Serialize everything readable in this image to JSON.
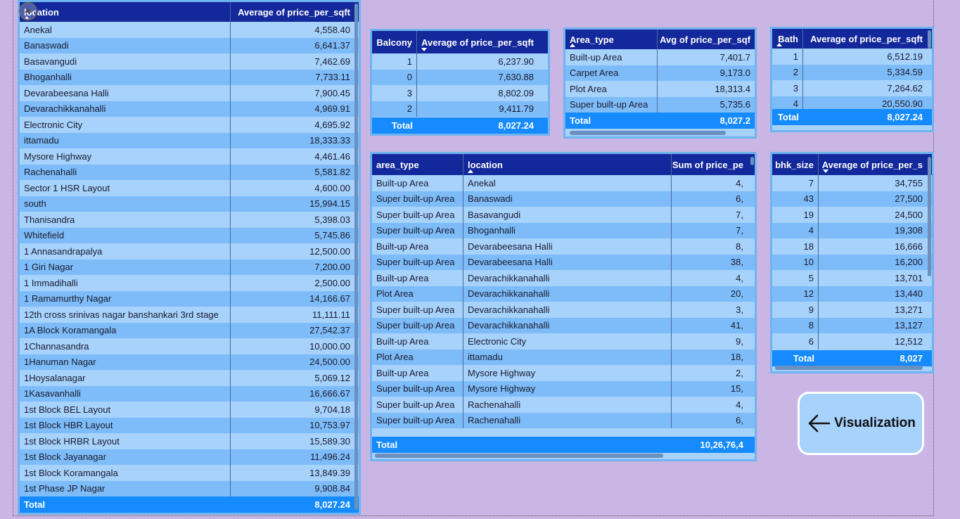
{
  "colors": {
    "header_bg": "#13289a",
    "row_light": "#a6d2fc",
    "row_dark": "#7dbcf8",
    "total_bg": "#168bff",
    "page_bg": "#c9b6e4"
  },
  "location_table": {
    "headers": [
      "location",
      "Average of price_per_sqft"
    ],
    "rows": [
      [
        "Anekal",
        "4,558.40"
      ],
      [
        "Banaswadi",
        "6,641.37"
      ],
      [
        "Basavangudi",
        "7,462.69"
      ],
      [
        "Bhoganhalli",
        "7,733.11"
      ],
      [
        "Devarabeesana Halli",
        "7,900.45"
      ],
      [
        "Devarachikkanahalli",
        "4,969.91"
      ],
      [
        "Electronic City",
        "4,695.92"
      ],
      [
        "ittamadu",
        "18,333.33"
      ],
      [
        "Mysore Highway",
        "4,461.46"
      ],
      [
        "Rachenahalli",
        "5,581.82"
      ],
      [
        "Sector 1 HSR Layout",
        "4,600.00"
      ],
      [
        "south",
        "15,994.15"
      ],
      [
        "Thanisandra",
        "5,398.03"
      ],
      [
        "Whitefield",
        "5,745.86"
      ],
      [
        "1 Annasandrapalya",
        "12,500.00"
      ],
      [
        "1 Giri Nagar",
        "7,200.00"
      ],
      [
        "1 Immadihalli",
        "2,500.00"
      ],
      [
        "1 Ramamurthy Nagar",
        "14,166.67"
      ],
      [
        "12th cross srinivas nagar banshankari 3rd stage",
        "11,111.11"
      ],
      [
        "1A Block Koramangala",
        "27,542.37"
      ],
      [
        "1Channasandra",
        "10,000.00"
      ],
      [
        "1Hanuman Nagar",
        "24,500.00"
      ],
      [
        "1Hoysalanagar",
        "5,069.12"
      ],
      [
        "1Kasavanhalli",
        "16,666.67"
      ],
      [
        "1st Block BEL Layout",
        "9,704.18"
      ],
      [
        "1st Block HBR Layout",
        "10,753.97"
      ],
      [
        "1st Block HRBR Layout",
        "15,589.30"
      ],
      [
        "1st Block Jayanagar",
        "11,496.24"
      ],
      [
        "1st Block Koramangala",
        "13,849.39"
      ],
      [
        "1st Phase JP Nagar",
        "9,908.84"
      ]
    ],
    "total": [
      "Total",
      "8,027.24"
    ]
  },
  "balcony_table": {
    "headers": [
      "Balcony",
      "Average of price_per_sqft"
    ],
    "rows": [
      [
        "1",
        "6,237.90"
      ],
      [
        "0",
        "7,630.88"
      ],
      [
        "3",
        "8,802.09"
      ],
      [
        "2",
        "9,411.79"
      ]
    ],
    "total": [
      "Total",
      "8,027.24"
    ]
  },
  "area_type_table": {
    "headers": [
      "Area_type",
      "Avg of price_per_sqf"
    ],
    "rows": [
      [
        "Built-up Area",
        "7,401.7"
      ],
      [
        "Carpet Area",
        "9,173.0"
      ],
      [
        "Plot Area",
        "18,313.4"
      ],
      [
        "Super built-up Area",
        "5,735.6"
      ]
    ],
    "total": [
      "Total",
      "8,027.2"
    ]
  },
  "bath_table": {
    "headers": [
      "Bath",
      "Average of price_per_sqft"
    ],
    "rows": [
      [
        "1",
        "6,512.19"
      ],
      [
        "2",
        "5,334.59"
      ],
      [
        "3",
        "7,264.62"
      ],
      [
        "4",
        "20,550.90"
      ]
    ],
    "total": [
      "Total",
      "8,027.24"
    ]
  },
  "area_location_table": {
    "headers": [
      "area_type",
      "location",
      "Sum of price_pe"
    ],
    "rows": [
      [
        "Built-up Area",
        "Anekal",
        "4,"
      ],
      [
        "Super built-up Area",
        "Banaswadi",
        "6,"
      ],
      [
        "Super built-up Area",
        "Basavangudi",
        "7,"
      ],
      [
        "Super built-up Area",
        "Bhoganhalli",
        "7,"
      ],
      [
        "Built-up Area",
        "Devarabeesana Halli",
        "8,"
      ],
      [
        "Super built-up Area",
        "Devarabeesana Halli",
        "38,"
      ],
      [
        "Built-up Area",
        "Devarachikkanahalli",
        "4,"
      ],
      [
        "Plot Area",
        "Devarachikkanahalli",
        "20,"
      ],
      [
        "Super built-up Area",
        "Devarachikkanahalli",
        "3,"
      ],
      [
        "Super built-up Area",
        "Devarachikkanahalli",
        "41,"
      ],
      [
        "Built-up Area",
        "Electronic City",
        "9,"
      ],
      [
        "Plot Area",
        "ittamadu",
        "18,"
      ],
      [
        "Built-up Area",
        "Mysore Highway",
        "2,"
      ],
      [
        "Super built-up Area",
        "Mysore Highway",
        "15,"
      ],
      [
        "Super built-up Area",
        "Rachenahalli",
        "4,"
      ],
      [
        "Super built-up Area",
        "Rachenahalli",
        "6,"
      ]
    ],
    "total": [
      "Total",
      "",
      "10,26,76,4"
    ]
  },
  "bhk_table": {
    "headers": [
      "bhk_size",
      "Average of price_per_s"
    ],
    "rows": [
      [
        "7",
        "34,755"
      ],
      [
        "43",
        "27,500"
      ],
      [
        "19",
        "24,500"
      ],
      [
        "4",
        "19,308"
      ],
      [
        "18",
        "16,666"
      ],
      [
        "10",
        "16,200"
      ],
      [
        "5",
        "13,701"
      ],
      [
        "12",
        "13,440"
      ],
      [
        "9",
        "13,271"
      ],
      [
        "8",
        "13,127"
      ],
      [
        "6",
        "12,512"
      ]
    ],
    "total": [
      "Total",
      "8,027"
    ]
  },
  "nav": {
    "label": "Visualization",
    "icon": "arrow-left-icon"
  }
}
